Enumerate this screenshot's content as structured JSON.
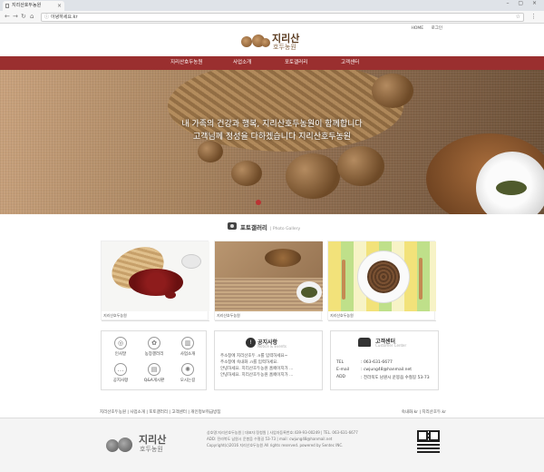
{
  "browser": {
    "tab_title": "지리산호두농원",
    "url": "아녕하세요.kr"
  },
  "util_links": [
    "HOME",
    "로그인"
  ],
  "logo": {
    "line1": "지리산",
    "line2": "호두농원"
  },
  "nav": [
    "지리산호두농원",
    "사업소개",
    "포토갤러리",
    "고객센터"
  ],
  "hero": {
    "line1": "내 가족의 건강과 행복, 지리산호두농원이 함께합니다",
    "line2": "고객님께 정성을 다하겠습니다  지리산호두농원"
  },
  "gallery": {
    "title": "포토갤러리",
    "subtitle": "| Photo Gallery",
    "items": [
      {
        "caption": "지리산호두농원"
      },
      {
        "caption": "지리산호두농원"
      },
      {
        "caption": "지리산호두농원"
      }
    ]
  },
  "quick_menu": [
    {
      "label": "인사말",
      "icon": "globe-icon",
      "glyph": "◎"
    },
    {
      "label": "농장갤러리",
      "icon": "plant-icon",
      "glyph": "✿"
    },
    {
      "label": "사업소개",
      "icon": "chart-icon",
      "glyph": "▥"
    },
    {
      "label": "공지사항",
      "icon": "chat-icon",
      "glyph": "…"
    },
    {
      "label": "Q&A게시판",
      "icon": "book-icon",
      "glyph": "▤"
    },
    {
      "label": "오시는길",
      "icon": "gear-icon",
      "glyph": "✺"
    }
  ],
  "notice": {
    "title": "공지사항",
    "subtitle": "Notice & Events",
    "items": [
      "주소창에 지리산호두 .n를 입력하세요~",
      "주소창에 숙내화 .n를 입력하세요.",
      "안녕하세요. 지리산호두농원 홈페이지가 ...",
      "안녕하세요. 지리산호두농원 홈페이지가 ..."
    ]
  },
  "customer_center": {
    "title": "고객센터",
    "subtitle": "Customer Center",
    "rows": [
      {
        "label": "TEL",
        "value": ": 063-631-6677"
      },
      {
        "label": "E-mail",
        "value": ": cwjung48@hanmail.net"
      },
      {
        "label": "ADD",
        "value": ": 전라북도 남원시 운봉읍 수철길 53-73"
      }
    ]
  },
  "footer": {
    "links": "지리산호두농원 | 사업소개 | 포토갤러리 | 고객센터 | 개인정보취급방침",
    "family": "숙내화.kr | 지리산호두.kr",
    "logo": {
      "line1": "지리산",
      "line2": "호두농원"
    },
    "info": [
      "상호명:지리산호두농원 | 대표자:정청원 | 사업자등록번호:439-93-00249 | TEL. 063-631-6677",
      "ADD: 전라북도 남원시 운봉읍 수철길 53-73 | mail: cwjung48@hanmail.net",
      "Copyright(c)2016 지리산호두농원 All rights reserved. powered by Sentec INC."
    ]
  }
}
